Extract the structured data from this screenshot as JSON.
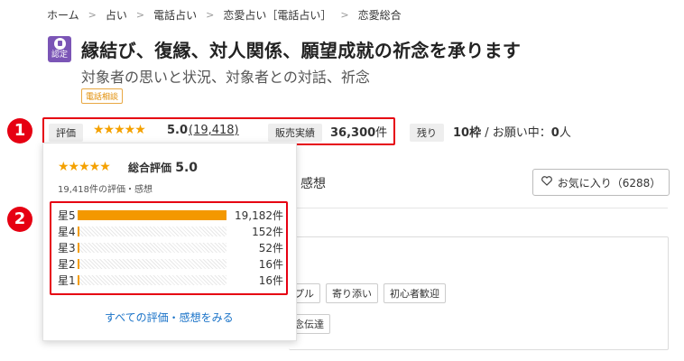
{
  "breadcrumb": [
    "ホーム",
    "占い",
    "電話占い",
    "恋愛占い［電話占い］",
    "恋愛総合"
  ],
  "breadcrumb_sep": ">",
  "auth_badge": "認定",
  "title": "縁結び、復縁、対人関係、願望成就の祈念を承ります",
  "subtitle": "対象者の思いと状況、対象者との対話、祈念",
  "tag": "電話相談",
  "markers": [
    "1",
    "2"
  ],
  "stats": {
    "rating_label": "評価",
    "stars": "★★★★★",
    "rating": "5.0",
    "review_count": "(19,418)",
    "sales_label": "販売実績",
    "sales_value": "36,300",
    "sales_unit": "件",
    "remaining_label": "残り",
    "remaining_value": "10枠",
    "slash": "/",
    "requesting_label": "お願い中：",
    "requesting_value": "0",
    "requesting_unit": "人"
  },
  "popup": {
    "stars": "★★★★★",
    "overall_label": "総合評価",
    "overall_value": "5.0",
    "count_text": "19,418件の評価・感想",
    "rows": [
      {
        "label": "星5",
        "count": "19,182件",
        "value": 19182
      },
      {
        "label": "星4",
        "count": "152件",
        "value": 152
      },
      {
        "label": "星3",
        "count": "52件",
        "value": 52
      },
      {
        "label": "星2",
        "count": "16件",
        "value": 16
      },
      {
        "label": "星1",
        "count": "16件",
        "value": 16
      }
    ],
    "see_all": "すべての評価・感想をみる"
  },
  "tab_reviews": "感想",
  "favorite": {
    "label": "お気に入り（6288）"
  },
  "chips_row1": [
    "プル",
    "寄り添い",
    "初心者歓迎"
  ],
  "chips_row2": [
    "念伝達"
  ],
  "colors": {
    "accent": "#f39800",
    "highlight": "#e60012",
    "badge": "#7b55b6",
    "link": "#1a73c8"
  }
}
